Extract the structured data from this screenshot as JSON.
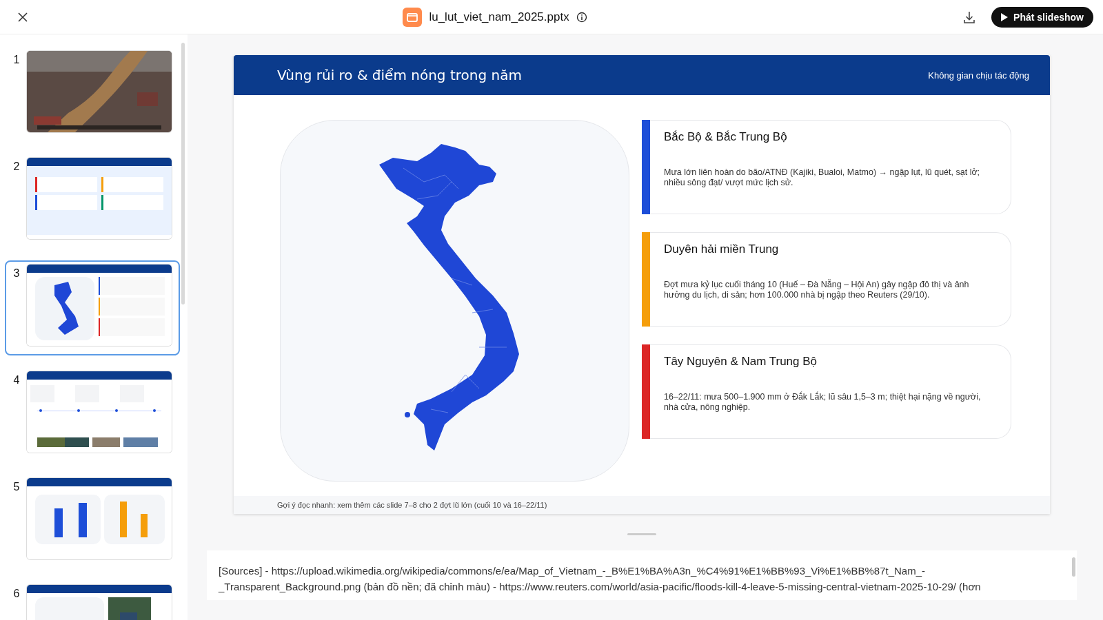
{
  "toolbar": {
    "file_name": "lu_lut_viet_nam_2025.pptx",
    "play_button": "Phát slideshow"
  },
  "thumbnails": [
    {
      "number": "1",
      "selected": false,
      "kind": "picture"
    },
    {
      "number": "2",
      "selected": false,
      "kind": "picture"
    },
    {
      "number": "3",
      "selected": true,
      "kind": "picture"
    },
    {
      "number": "4",
      "selected": false,
      "kind": "picture"
    },
    {
      "number": "5",
      "selected": false,
      "kind": "picture"
    },
    {
      "number": "6",
      "selected": false,
      "kind": "picture"
    }
  ],
  "slide": {
    "title": "Vùng rủi ro & điểm nóng trong năm",
    "subtitle": "Không gian chịu tác động",
    "regions": [
      {
        "title": "Bắc Bộ & Bắc Trung Bộ",
        "text": "Mưa lớn liên hoàn do bão/ATNĐ (Kajiki, Bualoi, Matmo) → ngập lụt, lũ quét, sạt lở; nhiều sông đạt/ vượt mức lịch sử.",
        "color": "#1d4ed8"
      },
      {
        "title": "Duyên hải miền Trung",
        "text": "Đợt mưa kỷ lục cuối tháng 10 (Huế – Đà Nẵng – Hội An) gây ngập đô thị và ảnh hưởng du lịch, di sản; hơn 100.000 nhà bị ngập theo Reuters (29/10).",
        "color": "#f59e0b"
      },
      {
        "title": "Tây Nguyên & Nam Trung Bộ",
        "text": "16–22/11: mưa 500–1.900 mm ở Đắk Lắk; lũ sâu 1,5–3 m; thiệt hại nặng về người, nhà cửa, nông nghiệp.",
        "color": "#dc2626"
      }
    ],
    "footer": "Gợi ý đọc nhanh: xem thêm các slide 7–8 cho 2 đợt lũ lớn (cuối 10 và 16–22/11)"
  },
  "notes": "[Sources] - https://upload.wikimedia.org/wikipedia/commons/e/ea/Map_of_Vietnam_-_B%E1%BA%A3n_%C4%91%E1%BB%93_Vi%E1%BB%87t_Nam_-_Transparent_Background.png (bản đồ nền; đã chỉnh màu) - https://www.reuters.com/world/asia-pacific/floods-kill-4-leave-5-missing-central-vietnam-2025-10-29/ (hơn"
}
